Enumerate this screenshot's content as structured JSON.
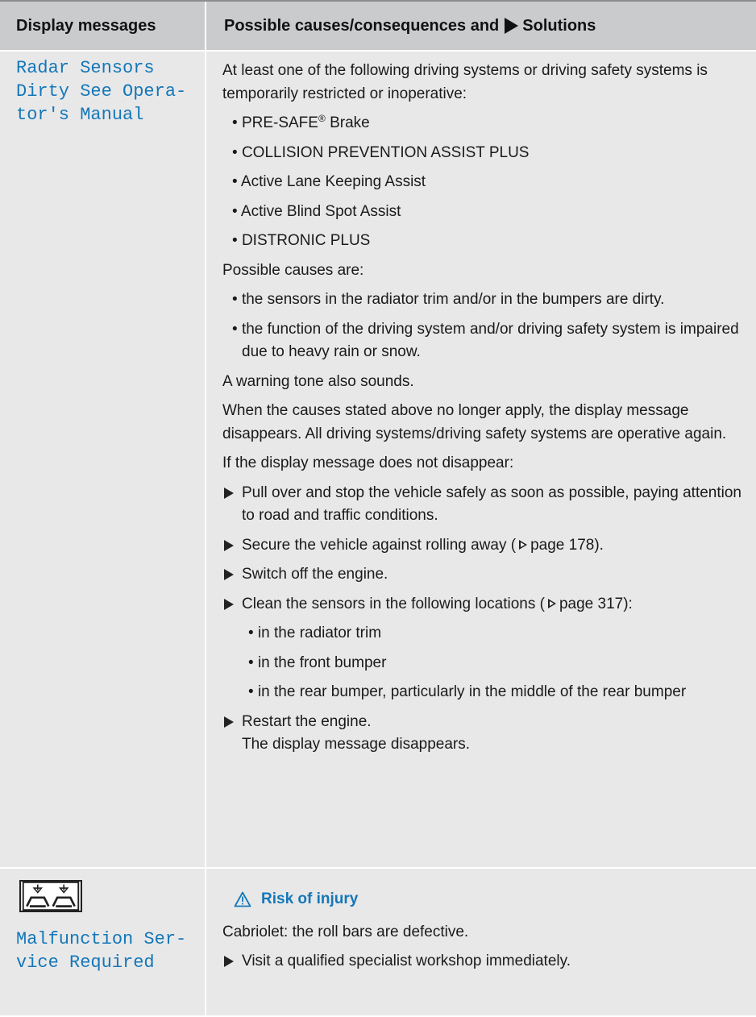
{
  "header": {
    "col1": "Display messages",
    "col2_before": "Possible causes/consequences and",
    "col2_after": "Solutions"
  },
  "row1": {
    "message_lines": [
      "Radar Sensors",
      "Dirty See Opera-",
      "tor's Manual"
    ],
    "intro": "At least one of the following driving systems or driving safety systems is temporarily restricted or inoperative:",
    "systems": [
      "PRE-SAFE",
      "COLLISION PREVENTION ASSIST PLUS",
      "Active Lane Keeping Assist",
      "Active Blind Spot Assist",
      "DISTRONIC PLUS"
    ],
    "presafe_suffix": "Brake",
    "causes_label": "Possible causes are:",
    "causes": [
      "the sensors in the radiator trim and/or in the bumpers are dirty.",
      "the function of the driving system and/or driving safety system is impaired due to heavy rain or snow."
    ],
    "tone": "A warning tone also sounds.",
    "no_longer": "When the causes stated above no longer apply, the display message disappears. All driving systems/driving safety systems are operative again.",
    "if_not": "If the display message does not disappear:",
    "step1": "Pull over and stop the vehicle safely as soon as possible, paying attention to road and traffic conditions.",
    "step2_text": "Secure the vehicle against rolling away (",
    "step2_page": "page 178).",
    "step3": "Switch off the engine.",
    "step4_text": "Clean the sensors in the following locations (",
    "step4_page": "page 317):",
    "locations": [
      "in the radiator trim",
      "in the front bumper",
      "in the rear bumper, particularly in the middle of the rear bumper"
    ],
    "step5": "Restart the engine.",
    "step5_result": "The display message disappears."
  },
  "row2": {
    "icon": "roll-bar-icon",
    "message_lines": [
      "Malfunction Ser-",
      "vice Required"
    ],
    "warning_title": "Risk of injury",
    "cabriolet": "Cabriolet: the roll bars are defective.",
    "step": "Visit a qualified specialist workshop immediately."
  },
  "colors": {
    "header_bg": "#c9cbcd",
    "row_bg": "#e8e8e9",
    "message_blue": "#1477b8"
  }
}
